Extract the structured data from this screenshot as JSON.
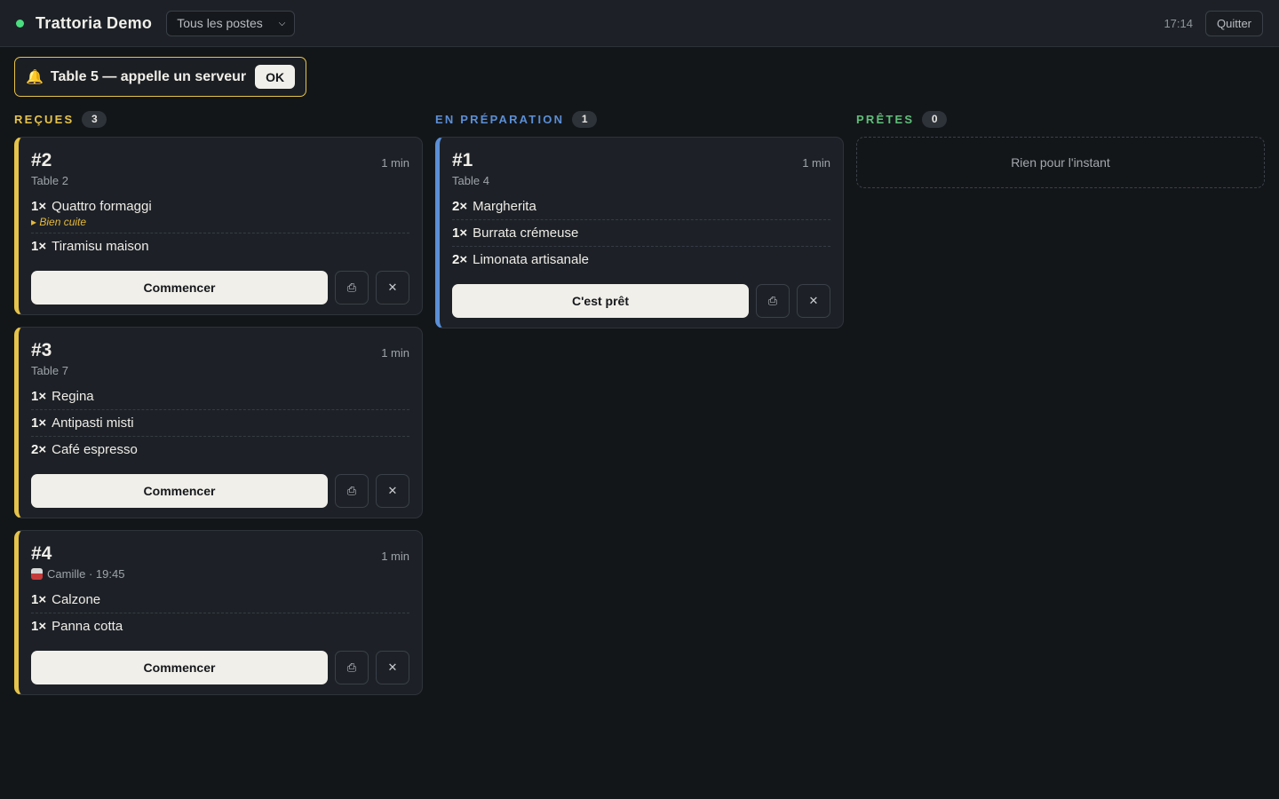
{
  "header": {
    "title": "Trattoria Demo",
    "station_select": "Tous les postes",
    "clock": "17:14",
    "quit_label": "Quitter"
  },
  "alert": {
    "text": "Table 5 — appelle un serveur",
    "ok_label": "OK"
  },
  "columns": {
    "received": {
      "title": "REÇUES",
      "count": "3",
      "color": "#e6c34a",
      "orders": [
        {
          "number": "#2",
          "elapsed": "1 min",
          "subtitle": "Table 2",
          "items": [
            {
              "qty": "1×",
              "name": "Quattro formaggi",
              "note": "▸ Bien cuite"
            },
            {
              "qty": "1×",
              "name": "Tiramisu maison"
            }
          ],
          "action_label": "Commencer"
        },
        {
          "number": "#3",
          "elapsed": "1 min",
          "subtitle": "Table 7",
          "items": [
            {
              "qty": "1×",
              "name": "Regina"
            },
            {
              "qty": "1×",
              "name": "Antipasti misti"
            },
            {
              "qty": "2×",
              "name": "Café espresso"
            }
          ],
          "action_label": "Commencer"
        },
        {
          "number": "#4",
          "elapsed": "1 min",
          "subtitle": "Camille · 19:45",
          "items": [
            {
              "qty": "1×",
              "name": "Calzone"
            },
            {
              "qty": "1×",
              "name": "Panna cotta"
            }
          ],
          "action_label": "Commencer"
        }
      ]
    },
    "preparing": {
      "title": "EN PRÉPARATION",
      "count": "1",
      "color": "#5b8fd6",
      "orders": [
        {
          "number": "#1",
          "elapsed": "1 min",
          "subtitle": "Table 4",
          "items": [
            {
              "qty": "2×",
              "name": "Margherita"
            },
            {
              "qty": "1×",
              "name": "Burrata crémeuse"
            },
            {
              "qty": "2×",
              "name": "Limonata artisanale"
            }
          ],
          "action_label": "C'est prêt"
        }
      ]
    },
    "ready": {
      "title": "PRÊTES",
      "count": "0",
      "color": "#5fbf7a",
      "empty_text": "Rien pour l'instant"
    }
  },
  "icons": {
    "status": "status-dot",
    "alert": "bell-icon",
    "print": "printer-icon",
    "cancel": "close-icon",
    "takeaway": "takeaway-bag-icon"
  }
}
